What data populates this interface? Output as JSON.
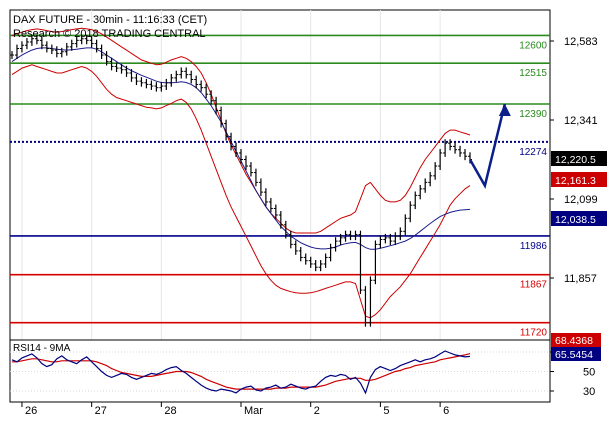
{
  "header": {
    "title": "DAX FUTURE - 30min - 11:16:33 (CET)",
    "subtitle": "Research © 2018 TRADING CENTRAL"
  },
  "colors": {
    "price": "#000000",
    "resistance": "#2a8a1e",
    "pivot": "#000080",
    "support_mid": "#00008b",
    "support": "#d40000",
    "bollinger": "#cc0000",
    "ma": "#1c1c8c",
    "arrow": "#0a1f8a",
    "rsi": "#000080",
    "rsi_ma": "#cc0000"
  },
  "chart_data": [
    {
      "type": "line",
      "name": "price",
      "x": [
        "26",
        "27",
        "28",
        "Mar",
        "2",
        "5",
        "6"
      ],
      "y_ticks": [
        "12,583",
        "12,341",
        "12,099",
        "11,857"
      ],
      "ylim": [
        11700,
        12650
      ],
      "levels": [
        {
          "label": "12600",
          "value": 12600,
          "kind": "resistance",
          "style": "solid"
        },
        {
          "label": "12515",
          "value": 12515,
          "kind": "resistance",
          "style": "solid"
        },
        {
          "label": "12390",
          "value": 12390,
          "kind": "resistance",
          "style": "solid"
        },
        {
          "label": "12274",
          "value": 12274,
          "kind": "pivot",
          "style": "dotted"
        },
        {
          "label": "11986",
          "value": 11986,
          "kind": "support_mid",
          "style": "solid"
        },
        {
          "label": "11867",
          "value": 11867,
          "kind": "support",
          "style": "solid"
        },
        {
          "label": "11720",
          "value": 11720,
          "kind": "support",
          "style": "solid"
        }
      ],
      "price_tags": [
        {
          "label": "12,220.5",
          "value": 12220,
          "kind": "price"
        },
        {
          "label": "12,161.3",
          "value": 12161,
          "kind": "bollinger"
        },
        {
          "label": "12,038.5",
          "value": 12038,
          "kind": "ma"
        }
      ],
      "series": {
        "price": [
          12540,
          12560,
          12570,
          12580,
          12590,
          12585,
          12570,
          12560,
          12555,
          12545,
          12550,
          12565,
          12575,
          12585,
          12590,
          12585,
          12575,
          12560,
          12540,
          12520,
          12505,
          12500,
          12495,
          12485,
          12470,
          12460,
          12455,
          12450,
          12445,
          12440,
          12445,
          12455,
          12470,
          12480,
          12490,
          12480,
          12465,
          12450,
          12440,
          12420,
          12400,
          12370,
          12330,
          12290,
          12260,
          12240,
          12220,
          12200,
          12180,
          12150,
          12120,
          12090,
          12070,
          12050,
          12020,
          11990,
          11960,
          11940,
          11920,
          11910,
          11900,
          11890,
          11900,
          11920,
          11950,
          11970,
          11980,
          11990,
          11985,
          11990,
          11820,
          11720,
          11850,
          11960,
          11975,
          11980,
          11970,
          11985,
          12000,
          12040,
          12080,
          12110,
          12130,
          12150,
          12170,
          12200,
          12240,
          12270,
          12260,
          12250,
          12240,
          12230,
          12220
        ],
        "bb_upper": [
          12600,
          12605,
          12610,
          12615,
          12618,
          12620,
          12618,
          12615,
          12612,
          12610,
          12612,
          12615,
          12618,
          12620,
          12622,
          12620,
          12618,
          12612,
          12605,
          12595,
          12585,
          12575,
          12565,
          12555,
          12545,
          12535,
          12525,
          12520,
          12515,
          12510,
          12512,
          12518,
          12525,
          12530,
          12535,
          12530,
          12520,
          12505,
          12485,
          12455,
          12420,
          12380,
          12340,
          12300,
          12265,
          12235,
          12205,
          12175,
          12150,
          12125,
          12100,
          12075,
          12055,
          12040,
          12025,
          12010,
          12000,
          11995,
          11995,
          11995,
          11995,
          11995,
          12000,
          12010,
          12020,
          12030,
          12040,
          12045,
          12050,
          12060,
          12100,
          12140,
          12150,
          12130,
          12110,
          12095,
          12090,
          12090,
          12095,
          12110,
          12135,
          12165,
          12195,
          12220,
          12240,
          12260,
          12280,
          12300,
          12310,
          12310,
          12305,
          12300,
          12295
        ],
        "bb_lower": [
          12480,
          12490,
          12500,
          12505,
          12510,
          12505,
          12500,
          12495,
          12490,
          12485,
          12485,
          12490,
          12495,
          12500,
          12505,
          12500,
          12490,
          12475,
          12455,
          12435,
          12420,
          12410,
          12405,
          12400,
          12395,
          12390,
          12385,
          12380,
          12378,
          12375,
          12378,
          12385,
          12392,
          12400,
          12405,
          12395,
          12375,
          12345,
          12310,
          12270,
          12230,
          12190,
          12150,
          12110,
          12075,
          12045,
          12015,
          11985,
          11955,
          11925,
          11895,
          11870,
          11850,
          11835,
          11825,
          11820,
          11815,
          11812,
          11810,
          11810,
          11812,
          11815,
          11820,
          11825,
          11830,
          11835,
          11840,
          11845,
          11845,
          11840,
          11790,
          11740,
          11735,
          11745,
          11760,
          11780,
          11800,
          11815,
          11830,
          11850,
          11870,
          11895,
          11920,
          11945,
          11970,
          11995,
          12020,
          12050,
          12080,
          12100,
          12115,
          12130,
          12140
        ],
        "ma": [
          12520,
          12530,
          12540,
          12548,
          12555,
          12560,
          12562,
          12562,
          12560,
          12558,
          12556,
          12555,
          12556,
          12558,
          12560,
          12562,
          12562,
          12558,
          12550,
          12540,
          12530,
          12520,
          12510,
          12500,
          12492,
          12485,
          12478,
          12472,
          12466,
          12460,
          12456,
          12455,
          12455,
          12456,
          12458,
          12456,
          12450,
          12440,
          12425,
          12405,
          12385,
          12360,
          12335,
          12305,
          12275,
          12245,
          12215,
          12185,
          12155,
          12125,
          12100,
          12075,
          12055,
          12035,
          12015,
          12000,
          11985,
          11975,
          11965,
          11958,
          11952,
          11948,
          11946,
          11946,
          11948,
          11952,
          11958,
          11962,
          11965,
          11966,
          11960,
          11950,
          11945,
          11945,
          11948,
          11952,
          11956,
          11960,
          11965,
          11970,
          11978,
          11988,
          12000,
          12012,
          12024,
          12035,
          12045,
          12052,
          12058,
          12062,
          12065,
          12066,
          12067
        ],
        "projection": [
          {
            "bar": 92,
            "value": 12220
          },
          {
            "bar": 95,
            "value": 12140
          },
          {
            "bar": 99,
            "value": 12390
          }
        ]
      }
    },
    {
      "type": "line",
      "name": "RSI14 - 9MA",
      "label": "RSI14 - 9MA",
      "y_ticks": [
        "70",
        "50",
        "30"
      ],
      "ylim": [
        20,
        80
      ],
      "value_tags": [
        {
          "label": "68.4368",
          "kind": "rsi_ma"
        },
        {
          "label": "65.5454",
          "kind": "rsi"
        }
      ],
      "series": {
        "rsi": [
          62,
          60,
          64,
          66,
          68,
          64,
          58,
          55,
          57,
          63,
          66,
          62,
          60,
          58,
          62,
          65,
          60,
          55,
          50,
          46,
          44,
          46,
          48,
          47,
          44,
          42,
          44,
          46,
          48,
          47,
          49,
          52,
          54,
          55,
          51,
          48,
          44,
          40,
          36,
          33,
          31,
          30,
          32,
          31,
          30,
          28,
          32,
          34,
          35,
          31,
          30,
          33,
          34,
          36,
          33,
          34,
          37,
          35,
          33,
          32,
          34,
          35,
          40,
          44,
          46,
          45,
          47,
          46,
          42,
          44,
          38,
          28,
          44,
          52,
          55,
          53,
          51,
          53,
          56,
          58,
          60,
          62,
          60,
          62,
          63,
          65,
          68,
          71,
          69,
          67,
          66,
          65,
          65.5
        ],
        "rsi_ma": [
          60,
          60,
          61,
          62,
          63,
          63,
          62,
          61,
          60,
          60,
          61,
          61,
          61,
          61,
          61,
          61,
          61,
          60,
          58,
          56,
          53,
          51,
          49,
          48,
          47,
          46,
          45,
          45,
          45,
          46,
          47,
          48,
          49,
          50,
          50,
          50,
          49,
          47,
          45,
          42,
          40,
          38,
          36,
          34,
          33,
          32,
          32,
          32,
          32,
          32,
          32,
          32,
          32,
          33,
          33,
          33,
          34,
          34,
          34,
          34,
          34,
          34,
          35,
          36,
          38,
          40,
          41,
          42,
          43,
          43,
          43,
          41,
          41,
          42,
          44,
          46,
          48,
          50,
          51,
          53,
          54,
          56,
          57,
          58,
          59,
          60,
          62,
          63,
          64,
          65,
          66,
          67,
          68.4
        ]
      }
    }
  ]
}
